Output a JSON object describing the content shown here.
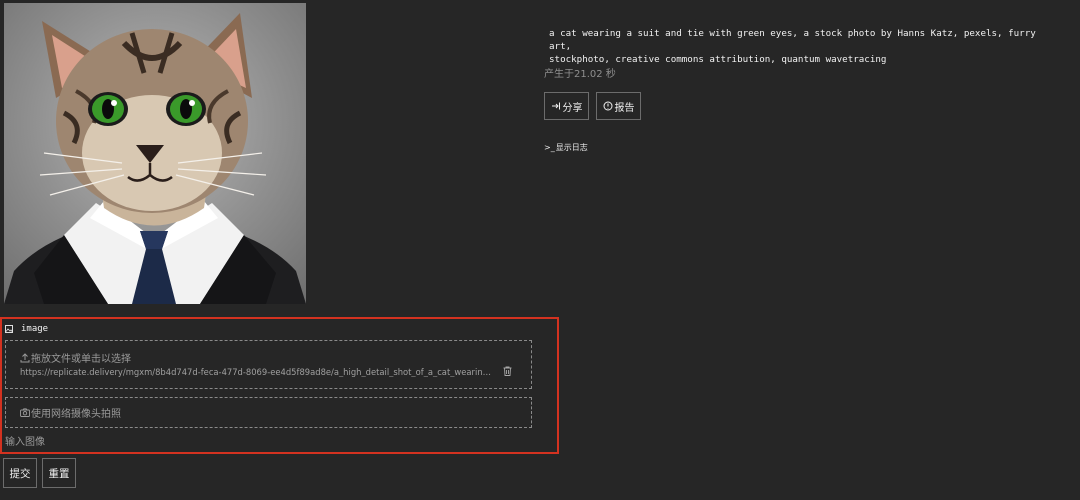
{
  "output": {
    "image_alt": "a cat wearing a suit and tie with green eyes",
    "caption": "a cat wearing a suit and tie with green eyes, a stock photo by Hanns Katz, pexels, furry art,\nstockphoto, creative commons attribution, quantum wavetracing",
    "timing": "产生于21.02 秒",
    "share_label": "分享",
    "report_label": "报告",
    "show_log_label": "显示日志"
  },
  "input": {
    "field_name": "image",
    "dropzone_label": "拖放文件或单击以选择",
    "file_url": "https://replicate.delivery/mgxm/8b4d747d-feca-477d-8069-ee4d5f89ad8e/a_high_detail_shot_of_a_cat_wearing_a_suit_realism_8k_-n_9.png",
    "webcam_label": "使用网络摄像头拍照",
    "field_description": "输入图像"
  },
  "actions": {
    "submit_label": "提交",
    "reset_label": "重置"
  },
  "colors": {
    "background": "#262626",
    "highlight_border": "#d33220",
    "cat_eye": "#3a9a2a"
  },
  "icons": {
    "share": "share-icon",
    "report": "info-circle-icon",
    "show_log": "chevron-right-icon",
    "image_field": "image-icon",
    "upload": "upload-icon",
    "delete": "trash-icon",
    "webcam": "camera-icon"
  }
}
